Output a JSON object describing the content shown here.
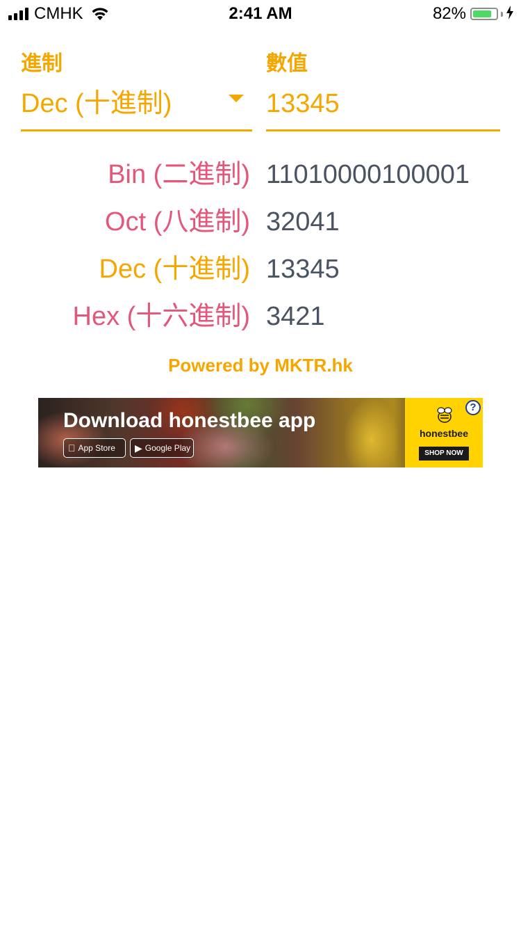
{
  "status_bar": {
    "carrier": "CMHK",
    "time": "2:41 AM",
    "battery_percent": "82%",
    "battery_level": 0.82,
    "charging_icon": "bolt-icon"
  },
  "form": {
    "base_label": "進制",
    "value_label": "數值",
    "selected_base": "Dec (十進制)",
    "input_value": "13345"
  },
  "results": [
    {
      "label": "Bin (二進制)",
      "value": "11010000100001",
      "color": "#e4577b"
    },
    {
      "label": "Oct (八進制)",
      "value": "32041",
      "color": "#e4577b"
    },
    {
      "label": "Dec (十進制)",
      "value": "13345",
      "color": "#f5a700"
    },
    {
      "label": "Hex (十六進制)",
      "value": "3421",
      "color": "#e4577b"
    }
  ],
  "footer": {
    "powered_by": "Powered by MKTR.hk"
  },
  "ad": {
    "headline": "Download honestbee app",
    "app_store": "App Store",
    "google_play": "Google Play",
    "brand": "honestbee",
    "cta": "SHOP NOW",
    "help": "?"
  },
  "colors": {
    "accent": "#f5a700",
    "label_pink": "#e4577b",
    "value_gray": "#4a5361",
    "ad_brand_yellow": "#ffd200"
  }
}
